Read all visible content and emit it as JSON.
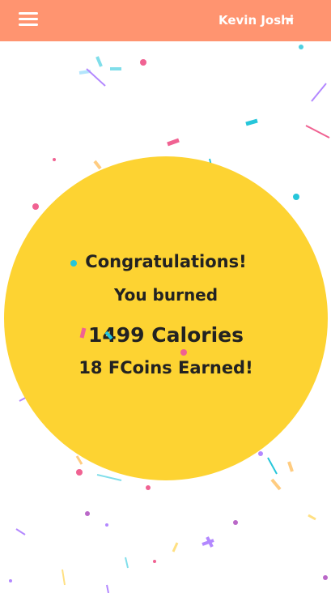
{
  "header": {
    "user_name": "Kevin Joshi",
    "background_color": "#ff9470",
    "menu_icon": "hamburger-menu-icon",
    "dropdown_icon": "caret-down-icon"
  },
  "celebration": {
    "congrats": "Congratulations!",
    "burned": "You burned",
    "calories": "1499 Calories",
    "coins": "18 FCoins Earned!",
    "circle_color": "#fdd332"
  },
  "confetti_colors": [
    "#f06292",
    "#4dd0e1",
    "#ffb74d",
    "#ba68c8",
    "#ffd54f",
    "#b388ff"
  ]
}
